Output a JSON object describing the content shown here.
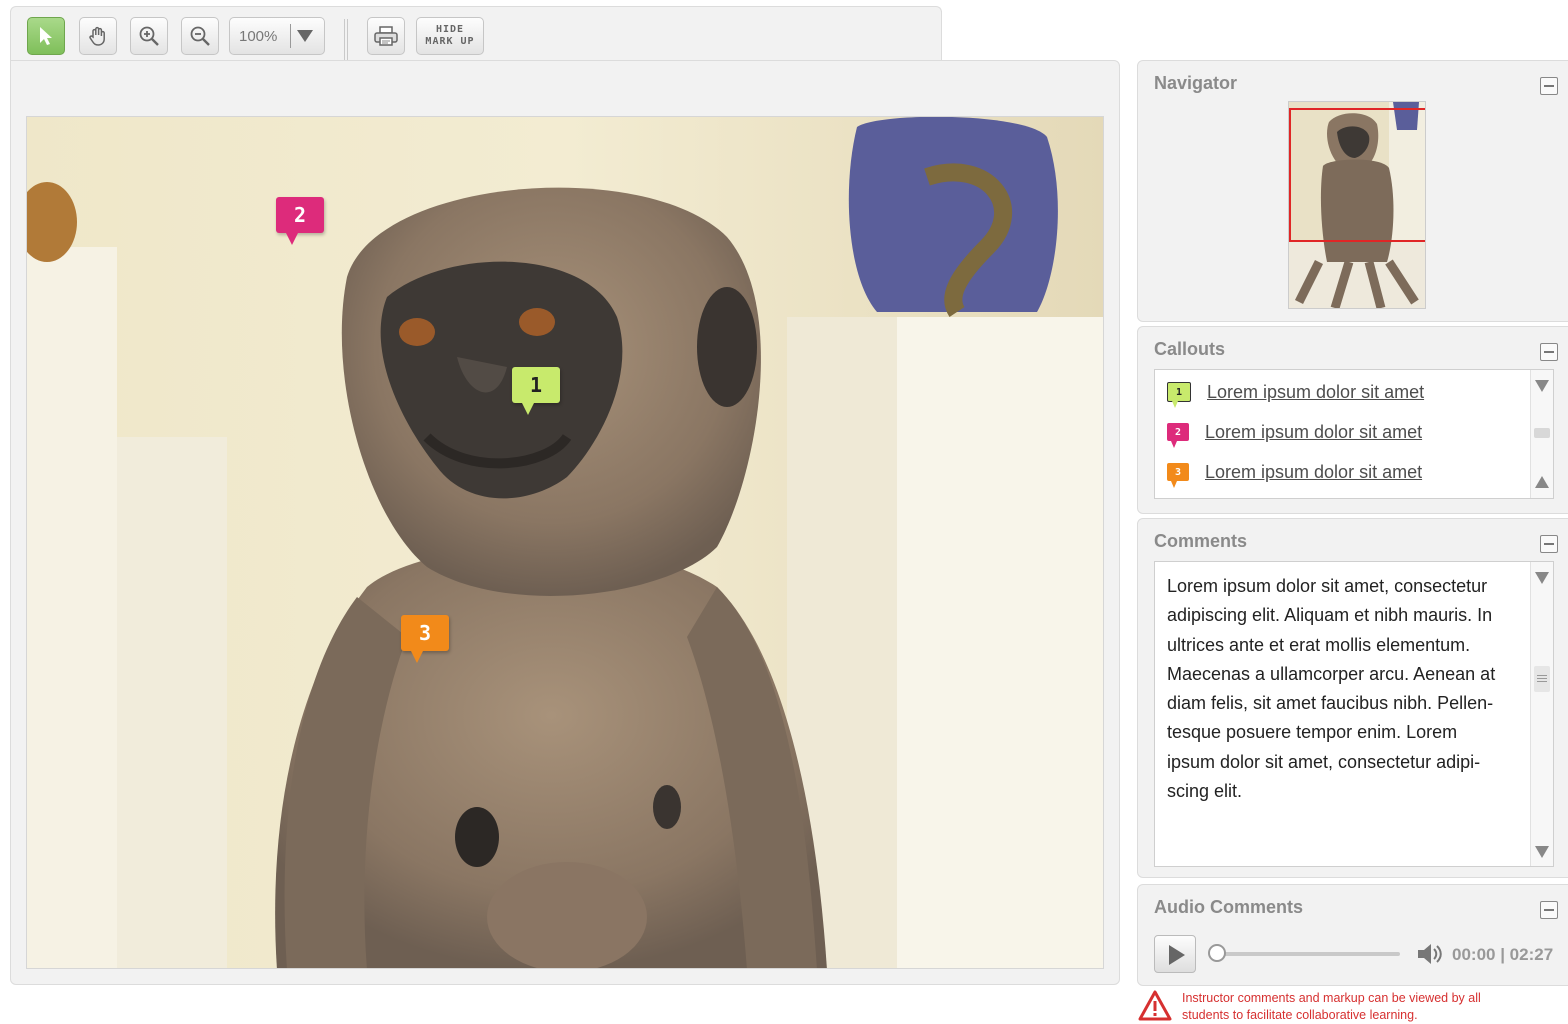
{
  "toolbar": {
    "tools": [
      "select-tool",
      "pan-tool",
      "zoom-in-tool",
      "zoom-out-tool",
      "print-tool"
    ],
    "zoom_value": "100%",
    "hide_markup_line1": "HIDE",
    "hide_markup_line2": "MARK UP"
  },
  "colors": {
    "callout_1": "#c8ea6c",
    "callout_2": "#dd2b7b",
    "callout_3": "#f28a1a",
    "navigator_frame": "#e02626",
    "notice": "#d63030",
    "active_tool": "#8cc866"
  },
  "markers": [
    {
      "number": "1"
    },
    {
      "number": "2"
    },
    {
      "number": "3"
    }
  ],
  "navigator": {
    "title": "Navigator"
  },
  "callouts": {
    "title": "Callouts",
    "items": [
      {
        "number": "1",
        "label": "Lorem ipsum dolor sit amet"
      },
      {
        "number": "2",
        "label": "Lorem ipsum dolor sit amet"
      },
      {
        "number": "3",
        "label": "Lorem ipsum dolor sit amet"
      }
    ]
  },
  "comments": {
    "title": "Comments",
    "lines": [
      "Lorem ipsum dolor sit amet, consectetur",
      "adipiscing elit. Aliquam et nibh mauris. In",
      "ultrices ante et erat mollis elementum.",
      "Maecenas a ullamcorper arcu. Aenean at",
      "diam felis, sit amet faucibus nibh. Pellen-",
      "tesque posuere tempor enim. Lorem",
      "ipsum dolor sit amet, consectetur adipi-",
      "scing elit."
    ]
  },
  "audio": {
    "title": "Audio Comments",
    "time": "00:00 | 02:27",
    "progress": 0
  },
  "notice": {
    "line1": "Instructor comments and markup can be viewed by all",
    "line2": "students to facilitate collaborative learning."
  }
}
